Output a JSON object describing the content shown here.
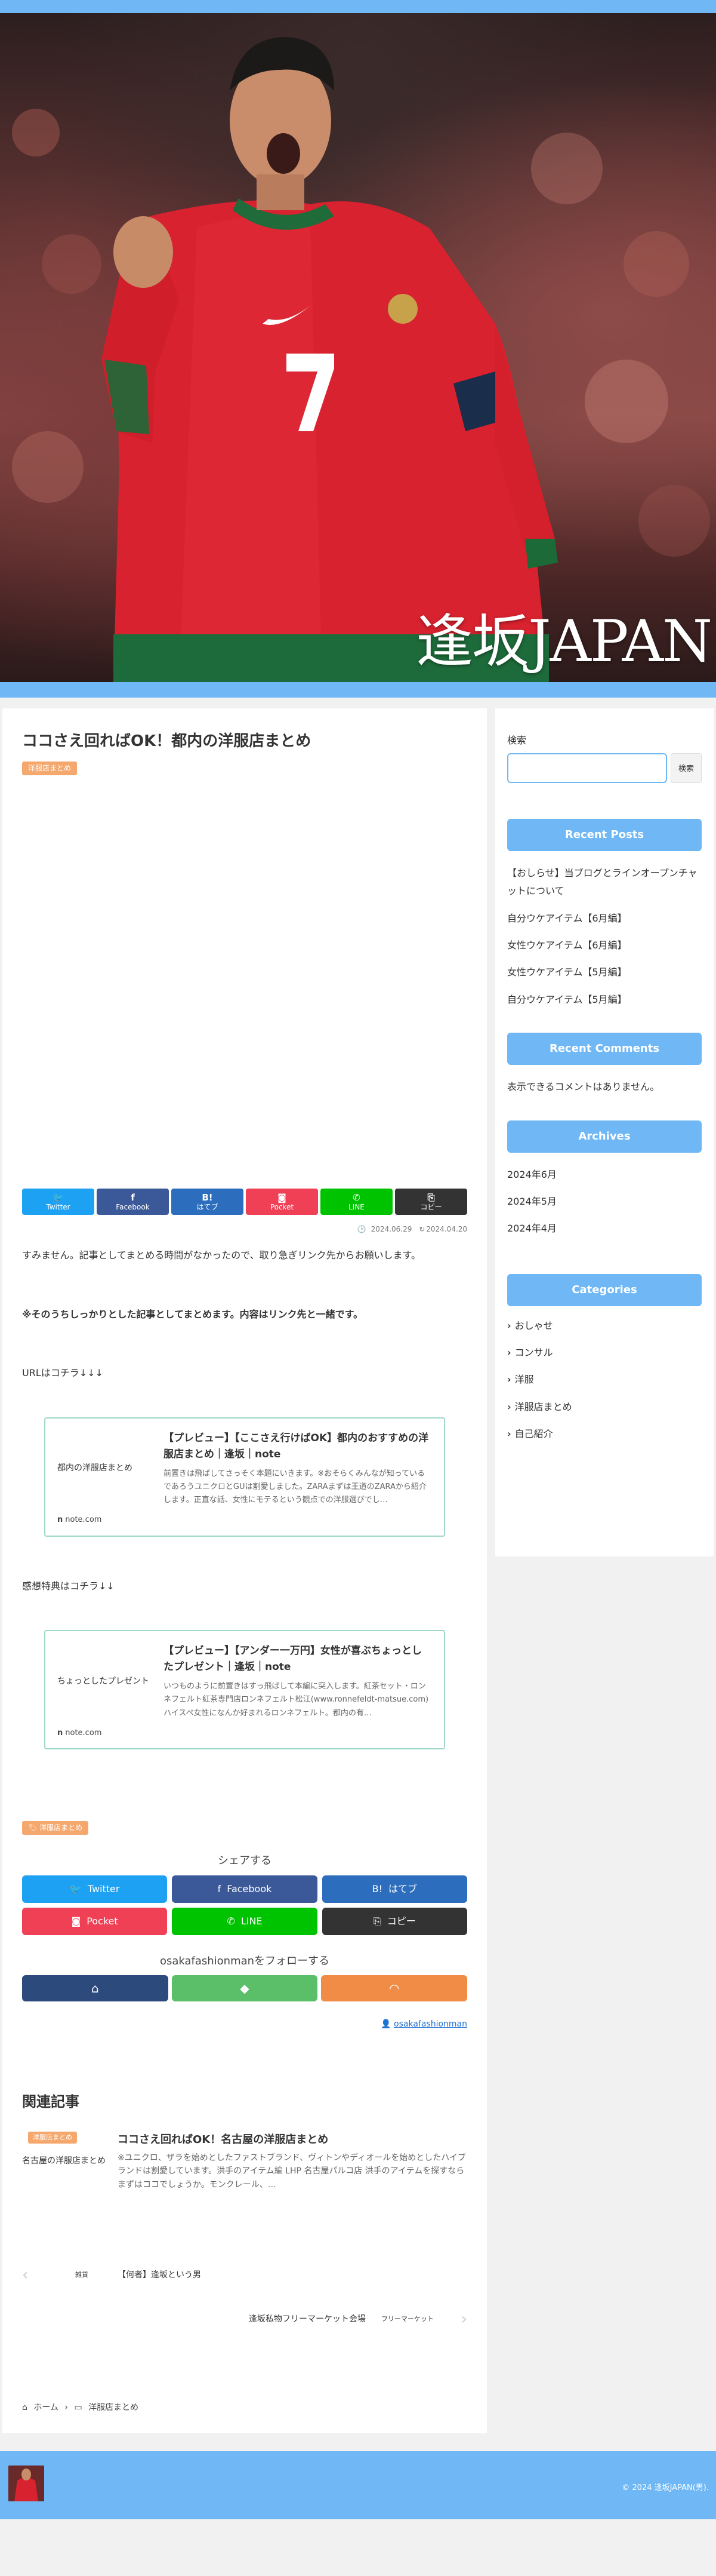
{
  "header": {
    "site_title": "逢坂JAPAN"
  },
  "post": {
    "title": "ココさえ回ればOK！都内の洋服店まとめ",
    "category": "洋服店まとめ",
    "share_small": [
      {
        "icon": "twitter-icon",
        "glyph": "🐦",
        "label": "Twitter",
        "color": "#1da1f2"
      },
      {
        "icon": "facebook-icon",
        "glyph": "f",
        "label": "Facebook",
        "color": "#3b5998"
      },
      {
        "icon": "hatena-icon",
        "glyph": "B!",
        "label": "はてブ",
        "color": "#2c6ebd"
      },
      {
        "icon": "pocket-icon",
        "glyph": "◙",
        "label": "Pocket",
        "color": "#ef4056"
      },
      {
        "icon": "line-icon",
        "glyph": "✆",
        "label": "LINE",
        "color": "#00c300"
      },
      {
        "icon": "copy-icon",
        "glyph": "⎘",
        "label": "コピー",
        "color": "#333333"
      }
    ],
    "published": "2024.06.29",
    "updated": "2024.04.20",
    "intro": "すみません。記事としてまとめる時間がなかったので、取り急ぎリンク先からお願いします。",
    "note_bold": "※そのうちしっかりとした記事としてまとめます。内容はリンク先と一緒です。",
    "url_label": "URLはコチラ↓↓↓",
    "card1": {
      "thumb": "都内の洋服店まとめ",
      "title": "【プレビュー】【ここさえ行けばOK】都内のおすすめの洋服店まとめ｜逢坂｜note",
      "desc": "前置きは飛ばしてさっそく本題にいきます。※おそらくみんなが知っているであろうユニクロとGUは割愛しました。ZARAまずは王道のZARAから紹介します。正直な話、女性にモテるという観点での洋服選びでし…",
      "source": "note.com"
    },
    "bonus_label": "感想特典はコチラ↓↓",
    "card2": {
      "thumb": "ちょっとしたプレゼント",
      "title": "【プレビュー】【アンダー一万円】女性が喜ぶちょっとしたプレゼント｜逢坂｜note",
      "desc": "いつものように前置きはすっ飛ばして本編に突入します。紅茶セット・ロンネフェルト紅茶専門店ロンネフェルト松江(www.ronnefeldt-matsue.com)ハイスペ女性になんか好まれるロンネフェルト。都内の有…",
      "source": "note.com"
    },
    "tag": "洋服店まとめ",
    "share_title": "シェアする",
    "share_big": [
      {
        "icon": "twitter-icon",
        "glyph": "🐦",
        "label": "Twitter",
        "color": "#1da1f2"
      },
      {
        "icon": "facebook-icon",
        "glyph": "f",
        "label": "Facebook",
        "color": "#3b5998"
      },
      {
        "icon": "hatena-icon",
        "glyph": "B!",
        "label": "はてブ",
        "color": "#2c6ebd"
      },
      {
        "icon": "pocket-icon",
        "glyph": "◙",
        "label": "Pocket",
        "color": "#ef4056"
      },
      {
        "icon": "line-icon",
        "glyph": "✆",
        "label": "LINE",
        "color": "#00c300"
      },
      {
        "icon": "copy-icon",
        "glyph": "⎘",
        "label": "コピー",
        "color": "#333333"
      }
    ],
    "follow_title": "osakafashionmanをフォローする",
    "author": "osakafashionman",
    "related_title": "関連記事",
    "related": {
      "badge": "洋服店まとめ",
      "thumb": "名古屋の洋服店まとめ",
      "title": "ココさえ回ればOK！名古屋の洋服店まとめ",
      "desc": "※ユニクロ、ザラを始めとしたファストブランド、ヴィトンやディオールを始めとしたハイブランドは割愛しています。洪手のアイテム編 LHP 名古屋パルコ店 洪手のアイテムを探すならまずはココでしょうか。モンクレール、…"
    },
    "prev": {
      "thumb": "雑貨",
      "title": "【何者】逢坂という男"
    },
    "next": {
      "thumb": "フリーマーケット",
      "title": "逢坂私物フリーマーケット会場"
    },
    "breadcrumb": {
      "home": "ホーム",
      "category": "洋服店まとめ"
    }
  },
  "sidebar": {
    "search_label": "検索",
    "search_value": "",
    "search_button": "検索",
    "recent_posts_title": "Recent Posts",
    "recent_posts": [
      "【おしらせ】当ブログとラインオープンチャットについて",
      "自分ウケアイテム【6月編】",
      "女性ウケアイテム【6月編】",
      "女性ウケアイテム【5月編】",
      "自分ウケアイテム【5月編】"
    ],
    "recent_comments_title": "Recent Comments",
    "no_comments": "表示できるコメントはありません。",
    "archives_title": "Archives",
    "archives": [
      "2024年6月",
      "2024年5月",
      "2024年4月"
    ],
    "categories_title": "Categories",
    "categories": [
      "おしゃせ",
      "コンサル",
      "洋服",
      "洋服店まとめ",
      "自己紹介"
    ]
  },
  "footer": {
    "copyright": "© 2024 逢坂JAPAN(男)."
  },
  "colors": {
    "accent": "#6fb8f5",
    "badge": "#f5a86e"
  }
}
